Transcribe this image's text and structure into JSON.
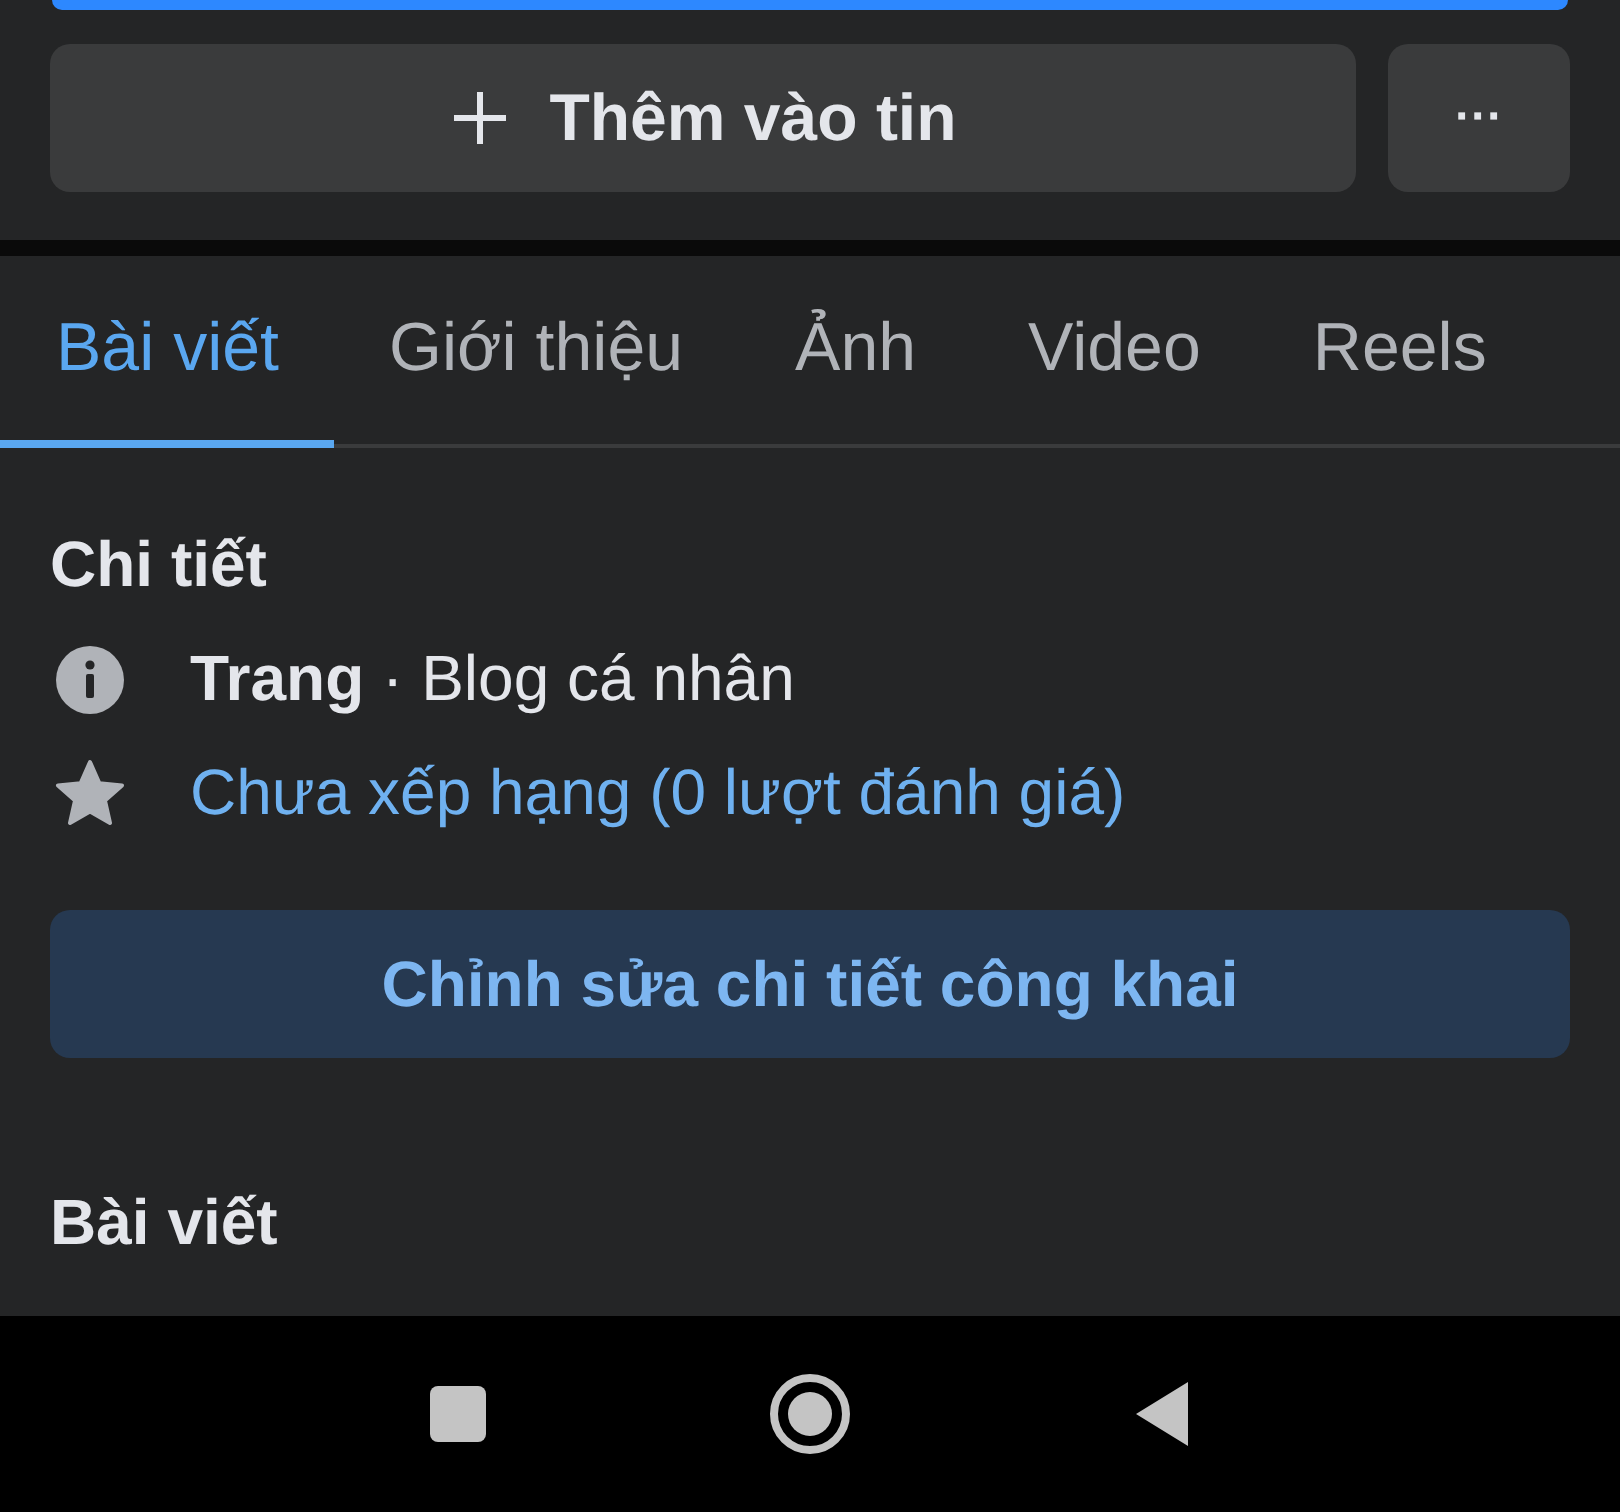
{
  "add_story_button": {
    "label": "Thêm vào tin"
  },
  "more_button": {
    "label": "···"
  },
  "tabs": [
    {
      "label": "Bài viết",
      "selected": true
    },
    {
      "label": "Giới thiệu",
      "selected": false
    },
    {
      "label": "Ảnh",
      "selected": false
    },
    {
      "label": "Video",
      "selected": false
    },
    {
      "label": "Reels",
      "selected": false
    }
  ],
  "details": {
    "heading": "Chi tiết",
    "rows": [
      {
        "kind": "info",
        "text": "**Trang** · Blog cá nhân"
      },
      {
        "kind": "rating",
        "text": "Chưa xếp hạng (0 lượt đánh giá)"
      }
    ],
    "edit_button": "Chỉnh sửa chi tiết công khai"
  },
  "posts_heading": "Bài viết"
}
